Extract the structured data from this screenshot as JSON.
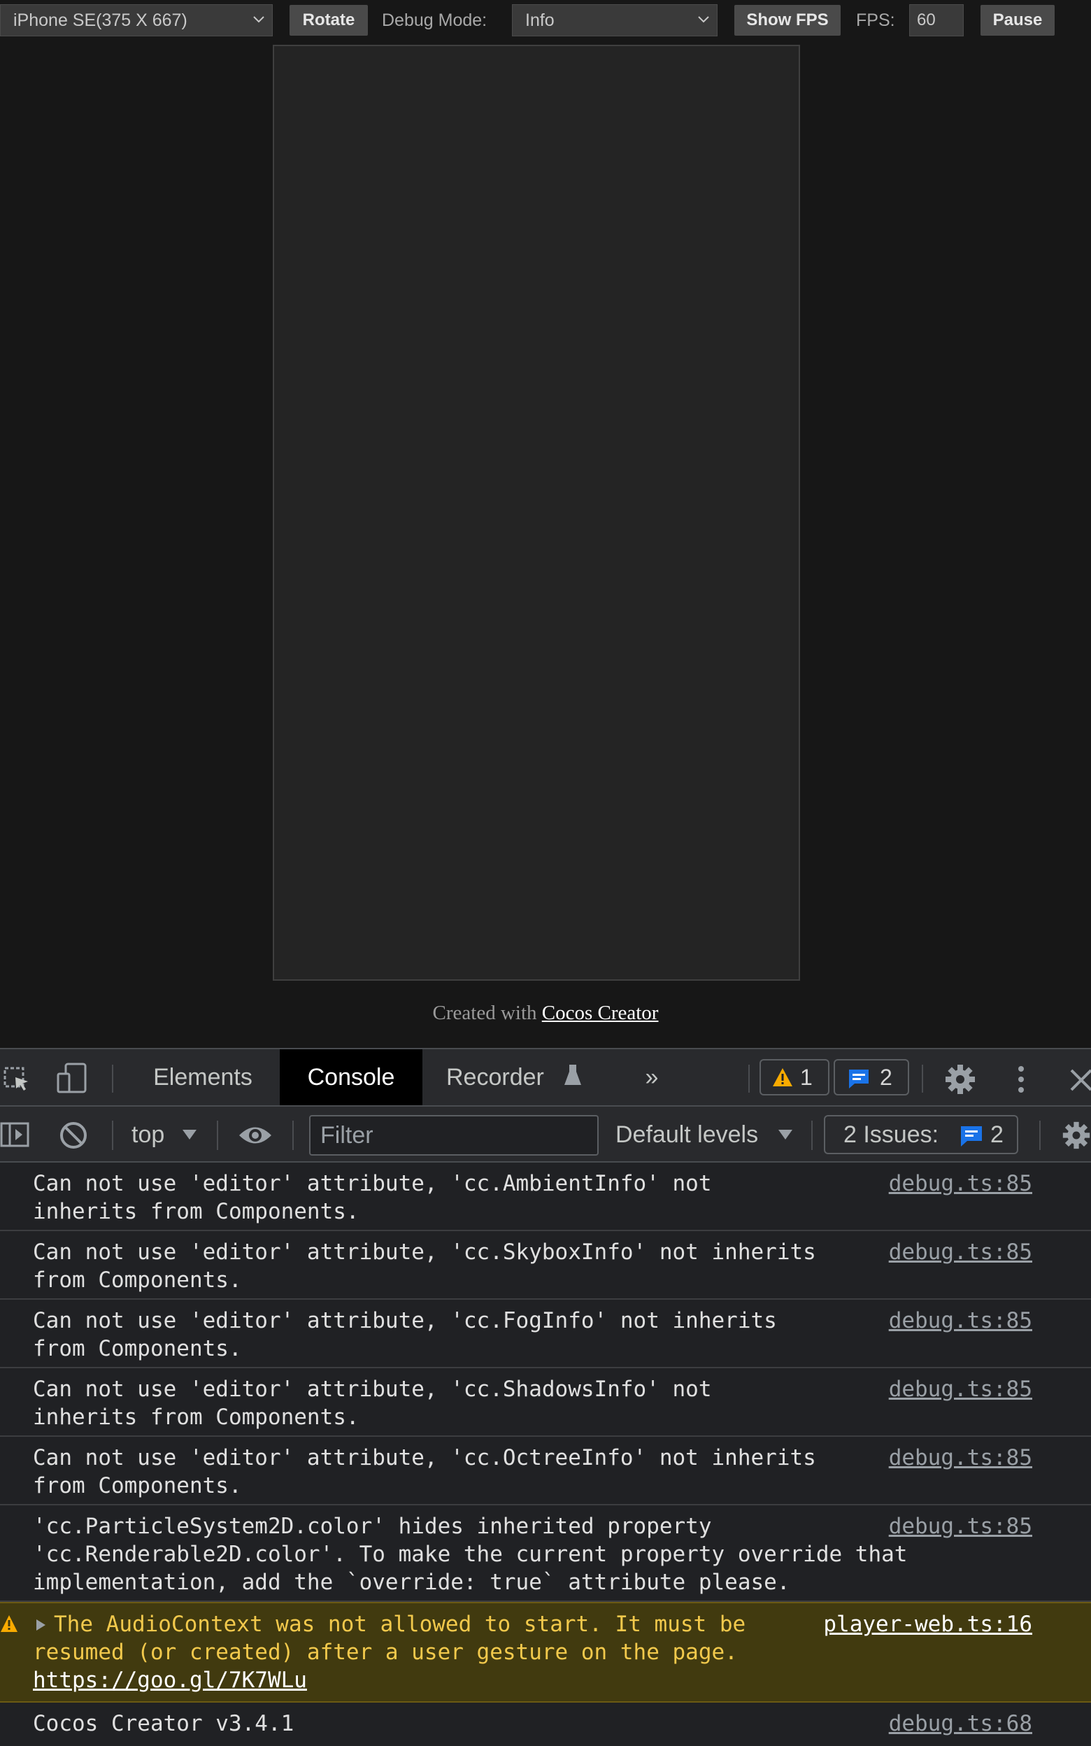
{
  "toolbar": {
    "device_select": "iPhone SE(375 X 667)",
    "rotate_label": "Rotate",
    "debug_mode_label": "Debug Mode:",
    "debug_mode_value": "Info",
    "show_fps_label": "Show FPS",
    "fps_label": "FPS:",
    "fps_value": "60",
    "pause_label": "Pause"
  },
  "footer": {
    "created_with": "Created with",
    "link_text": "Cocos Creator"
  },
  "devtools": {
    "tabs": {
      "elements": "Elements",
      "console": "Console",
      "recorder": "Recorder",
      "more": "»"
    },
    "warning_count": "1",
    "message_count": "2",
    "context": "top",
    "filter_placeholder": "Filter",
    "levels": "Default levels",
    "issues_label": "2 Issues:",
    "issues_count": "2"
  },
  "console_logs": [
    {
      "message": "Can not use 'editor' attribute, 'cc.AmbientInfo' not\ninherits from Components.",
      "source": "debug.ts:85"
    },
    {
      "message": "Can not use 'editor' attribute, 'cc.SkyboxInfo' not inherits\nfrom Components.",
      "source": "debug.ts:85"
    },
    {
      "message": "Can not use 'editor' attribute, 'cc.FogInfo' not inherits\nfrom Components.",
      "source": "debug.ts:85"
    },
    {
      "message": "Can not use 'editor' attribute, 'cc.ShadowsInfo' not\ninherits from Components.",
      "source": "debug.ts:85"
    },
    {
      "message": "Can not use 'editor' attribute, 'cc.OctreeInfo' not inherits\nfrom Components.",
      "source": "debug.ts:85"
    },
    {
      "message": "'cc.ParticleSystem2D.color' hides inherited property\n'cc.Renderable2D.color'. To make the current property override that\nimplementation, add the `override: true` attribute please.",
      "source": "debug.ts:85"
    },
    {
      "message": "The AudioContext was not allowed to start. It must be\nresumed (or created) after a user gesture on the page. ",
      "link": "https://goo.gl/7K7WLu",
      "source": "player-web.ts:16"
    },
    {
      "message": "Cocos Creator v3.4.1",
      "source": "debug.ts:68"
    }
  ]
}
